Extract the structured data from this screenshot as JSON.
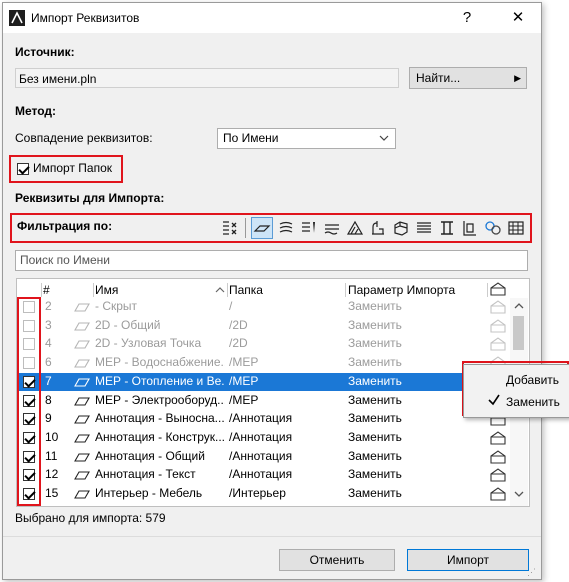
{
  "window": {
    "title": "Импорт Реквизитов",
    "help": "?",
    "close": "✕"
  },
  "source": {
    "label": "Источник:",
    "value": "Без имени.pln",
    "browse_button": "Найти..."
  },
  "method": {
    "label": "Метод:",
    "match_label": "Совпадение реквизитов:",
    "match_value": "По Имени"
  },
  "import_folders": {
    "label": "Импорт Папок",
    "checked": true
  },
  "attributes": {
    "label": "Реквизиты для Импорта:",
    "filter_label": "Фильтрация по:",
    "search_placeholder": "Поиск по Имени"
  },
  "filter_icons": [
    "all-types-icon",
    "layers-icon",
    "pens-icon",
    "line-types-icon",
    "fills-icon",
    "composites-icon",
    "building-materials-icon",
    "profiles-icon",
    "surfaces-icon",
    "zone-categories-icon",
    "mep-systems-icon",
    "operation-profiles-icon",
    "markup-styles-icon",
    "renovation-filters-icon",
    "graphic-overrides-icon"
  ],
  "table": {
    "columns": [
      "#",
      "Имя",
      "Папка",
      "Параметр Импорта"
    ],
    "rows": [
      {
        "checked": false,
        "num": "2",
        "name": "- Скрыт",
        "folder": "/",
        "param": "Заменить",
        "dim": true,
        "selected": false
      },
      {
        "checked": false,
        "num": "3",
        "name": "2D - Общий",
        "folder": "/2D",
        "param": "Заменить",
        "dim": true,
        "selected": false
      },
      {
        "checked": false,
        "num": "4",
        "name": "2D - Узловая Точка",
        "folder": "/2D",
        "param": "Заменить",
        "dim": true,
        "selected": false
      },
      {
        "checked": false,
        "num": "6",
        "name": "МЕР - Водоснабжение...",
        "folder": "/МЕР",
        "param": "Заменить",
        "dim": true,
        "selected": false
      },
      {
        "checked": true,
        "num": "7",
        "name": "МЕР - Отопление и Ве...",
        "folder": "/МЕР",
        "param": "Заменить",
        "dim": false,
        "selected": true
      },
      {
        "checked": true,
        "num": "8",
        "name": "МЕР - Электрооборуд...",
        "folder": "/МЕР",
        "param": "Заменить",
        "dim": false,
        "selected": false
      },
      {
        "checked": true,
        "num": "9",
        "name": "Аннотация - Выносна...",
        "folder": "/Аннотация",
        "param": "Заменить",
        "dim": false,
        "selected": false
      },
      {
        "checked": true,
        "num": "10",
        "name": "Аннотация - Конструк...",
        "folder": "/Аннотация",
        "param": "Заменить",
        "dim": false,
        "selected": false
      },
      {
        "checked": true,
        "num": "11",
        "name": "Аннотация - Общий",
        "folder": "/Аннотация",
        "param": "Заменить",
        "dim": false,
        "selected": false
      },
      {
        "checked": true,
        "num": "12",
        "name": "Аннотация - Текст",
        "folder": "/Аннотация",
        "param": "Заменить",
        "dim": false,
        "selected": false
      },
      {
        "checked": true,
        "num": "15",
        "name": "Интерьер - Мебель",
        "folder": "/Интерьер",
        "param": "Заменить",
        "dim": false,
        "selected": false
      }
    ]
  },
  "context_menu": {
    "items": [
      {
        "label": "Добавить",
        "checked": false
      },
      {
        "label": "Заменить",
        "checked": true
      }
    ]
  },
  "status": {
    "selected_text": "Выбрано для импорта: 579"
  },
  "buttons": {
    "cancel": "Отменить",
    "import": "Импорт"
  },
  "colors": {
    "accent": "#1b78d6",
    "highlight": "#e0141c"
  }
}
